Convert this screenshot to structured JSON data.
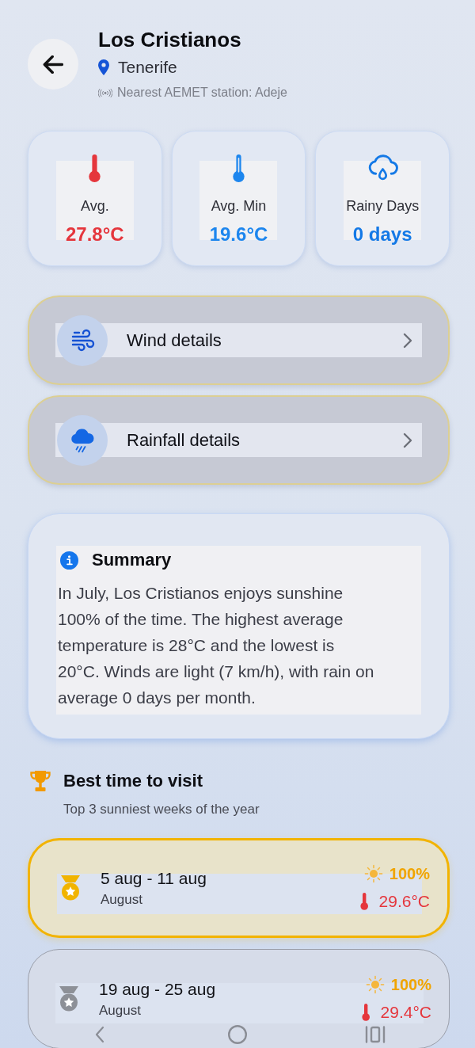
{
  "header": {
    "title": "Los Cristianos",
    "location": "Tenerife",
    "station": "Nearest AEMET station: Adeje"
  },
  "stats": [
    {
      "kind": "warm",
      "label": "Avg.",
      "value": "27.8°C"
    },
    {
      "kind": "cool",
      "label": "Avg. Min",
      "value": "19.6°C"
    },
    {
      "kind": "rain",
      "label": "Rainy Days",
      "value": "0 days"
    }
  ],
  "details": [
    {
      "kind": "wind",
      "label": "Wind details"
    },
    {
      "kind": "rain",
      "label": "Rainfall details"
    }
  ],
  "summary": {
    "title": "Summary",
    "text": "In July, Los Cristianos enjoys sunshine 100% of the time. The highest average temperature is 28°C and the lowest is 20°C. Winds are light (7 km/h), with rain on average 0 days per month."
  },
  "best_time": {
    "title": "Best time to visit",
    "subtitle": "Top 3 sunniest weeks of the year",
    "weeks": [
      {
        "kind": "gold",
        "range": "5 aug - 11 aug",
        "month": "August",
        "sunshine": "100%",
        "temperature": "29.6°C"
      },
      {
        "kind": "silver",
        "range": "19 aug - 25 aug",
        "month": "August",
        "sunshine": "100%",
        "temperature": "29.4°C"
      }
    ]
  }
}
